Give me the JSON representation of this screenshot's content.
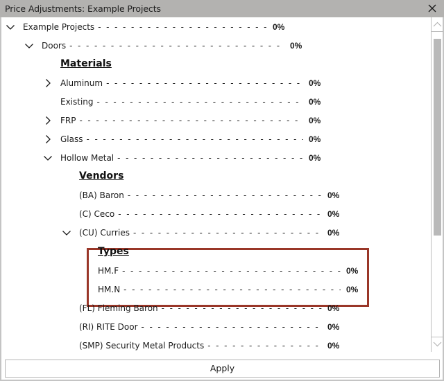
{
  "window": {
    "title": "Price Adjustments: Example Projects",
    "close_icon": "close-icon"
  },
  "tree": {
    "rows": [
      {
        "kind": "item",
        "level": 0,
        "chevron": "down",
        "label": "Example Projects",
        "value": "0%"
      },
      {
        "kind": "item",
        "level": 1,
        "chevron": "down",
        "label": "Doors",
        "value": "0%"
      },
      {
        "kind": "header",
        "level": 2,
        "label": "Materials"
      },
      {
        "kind": "item",
        "level": 2,
        "chevron": "right",
        "label": "Aluminum",
        "value": "0%"
      },
      {
        "kind": "item",
        "level": 2,
        "chevron": "none",
        "label": "Existing",
        "value": "0%"
      },
      {
        "kind": "item",
        "level": 2,
        "chevron": "right",
        "label": "FRP",
        "value": "0%"
      },
      {
        "kind": "item",
        "level": 2,
        "chevron": "right",
        "label": "Glass",
        "value": "0%"
      },
      {
        "kind": "item",
        "level": 2,
        "chevron": "down",
        "label": "Hollow Metal",
        "value": "0%"
      },
      {
        "kind": "header",
        "level": 3,
        "label": "Vendors"
      },
      {
        "kind": "item",
        "level": 3,
        "chevron": "none",
        "label": "(BA) Baron",
        "value": "0%"
      },
      {
        "kind": "item",
        "level": 3,
        "chevron": "none",
        "label": "(C) Ceco",
        "value": "0%"
      },
      {
        "kind": "item",
        "level": 3,
        "chevron": "down",
        "label": "(CU) Curries",
        "value": "0%"
      },
      {
        "kind": "header",
        "level": 4,
        "label": "Types"
      },
      {
        "kind": "item",
        "level": 4,
        "chevron": "none",
        "label": "HM.F",
        "value": "0%"
      },
      {
        "kind": "item",
        "level": 4,
        "chevron": "none",
        "label": "HM.N",
        "value": "0%"
      },
      {
        "kind": "item",
        "level": 3,
        "chevron": "none",
        "label": "(FL) Fleming Baron",
        "value": "0%"
      },
      {
        "kind": "item",
        "level": 3,
        "chevron": "none",
        "label": "(RI) RITE Door",
        "value": "0%"
      },
      {
        "kind": "item",
        "level": 3,
        "chevron": "none",
        "label": "(SMP) Security Metal Products",
        "value": "0%"
      }
    ],
    "highlight_color": "#993628"
  },
  "footer": {
    "apply_label": "Apply"
  },
  "colors": {
    "titlebar": "#b3b2b0",
    "scroll_thumb": "#b9b9b9"
  }
}
